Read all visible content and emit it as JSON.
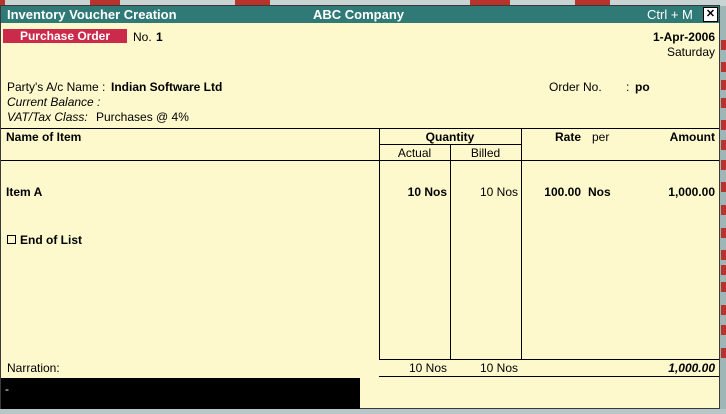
{
  "window": {
    "title": "Inventory Voucher  Creation",
    "company": "ABC Company",
    "shortcut": "Ctrl + M",
    "close_glyph": "✕"
  },
  "voucher": {
    "type_label": "Purchase Order",
    "no_label": "No.",
    "no_value": "1",
    "date": "1-Apr-2006",
    "day": "Saturday"
  },
  "party": {
    "name_label": "Party's A/c Name :",
    "name_value": "Indian Software Ltd",
    "balance_label": "Current Balance :",
    "vat_label": "VAT/Tax Class:",
    "vat_value": "Purchases @ 4%",
    "order_label": "Order No.",
    "order_colon": ":",
    "order_value": "po"
  },
  "table": {
    "headers": {
      "name": "Name of Item",
      "quantity": "Quantity",
      "actual": "Actual",
      "billed": "Billed",
      "rate": "Rate",
      "per": "per",
      "amount": "Amount"
    },
    "rows": [
      {
        "item": "Item A",
        "actual": "10 Nos",
        "billed": "10 Nos",
        "rate": "100.00",
        "per": "Nos",
        "amount": "1,000.00"
      }
    ],
    "end_of_list": "End of List",
    "narration_label": "Narration:",
    "total_actual": "10 Nos",
    "total_billed": "10 Nos",
    "total_amount": "1,000.00"
  },
  "status_bar": {
    "text": "-"
  },
  "colors": {
    "title_bar": "#2f7a76",
    "voucher_badge": "#cc2a4a",
    "background": "#fdf9cd"
  }
}
